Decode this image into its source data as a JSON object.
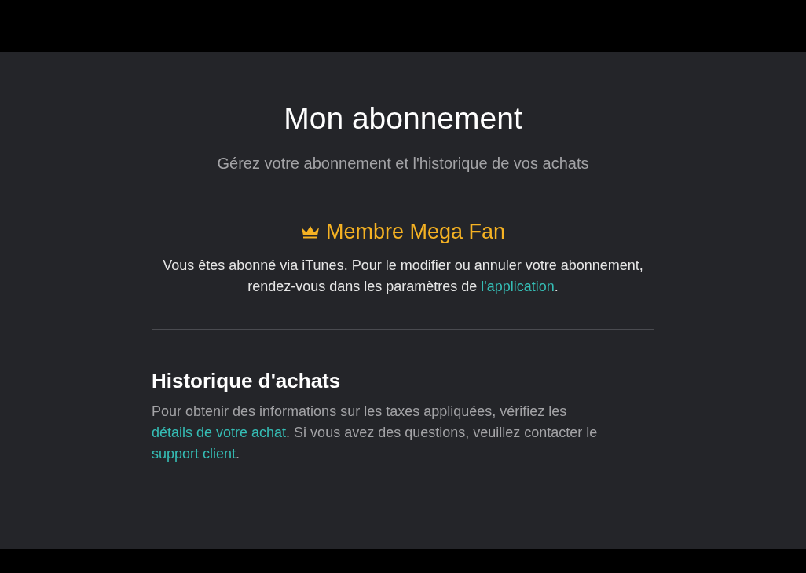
{
  "page": {
    "title": "Mon abonnement",
    "subtitle": "Gérez votre abonnement et l'historique de vos achats"
  },
  "membership": {
    "title": "Membre Mega Fan",
    "text": [
      {
        "kind": "text",
        "text": "Vous êtes abonné via iTunes. Pour le modifier ou annuler votre abonnement, rendez-vous dans les paramètres de "
      },
      {
        "kind": "link",
        "text": "l'application"
      },
      {
        "kind": "text",
        "text": "."
      }
    ]
  },
  "history": {
    "title": "Historique d'achats",
    "text": [
      {
        "kind": "text",
        "text": "Pour obtenir des informations sur les taxes appliquées, vérifiez les "
      },
      {
        "kind": "link",
        "text": "détails de votre achat"
      },
      {
        "kind": "text",
        "text": ". Si vous avez des questions, veuillez contacter le "
      },
      {
        "kind": "link",
        "text": "support client"
      },
      {
        "kind": "text",
        "text": "."
      }
    ]
  }
}
